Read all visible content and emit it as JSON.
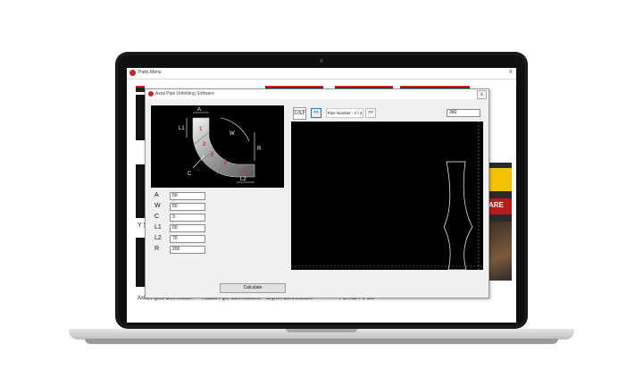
{
  "parts_menu": {
    "title": "Parts Menu",
    "close_label": "x",
    "y_label": "Y S",
    "captions": [
      "Axial Pipes Connection",
      "Radial Pipe Connections",
      "Expert Connections",
      "PLANE PIPES"
    ],
    "ad_text": "ARE"
  },
  "dialog": {
    "title": "Axial Pipe Unfolding Software",
    "close_label": "x",
    "diagram_labels": {
      "A": "A",
      "L1": "L1",
      "W": "W",
      "R": "R",
      "C": "C",
      "L2": "L2",
      "segments": [
        "1",
        "2",
        "2",
        "2",
        "3"
      ]
    },
    "params": [
      {
        "label": "A",
        "value": "50"
      },
      {
        "label": "W",
        "value": "50"
      },
      {
        "label": "C",
        "value": "3"
      },
      {
        "label": "L1",
        "value": "50"
      },
      {
        "label": "L2",
        "value": "70"
      },
      {
        "label": "R",
        "value": "200"
      }
    ],
    "calculate_label": "Calculate",
    "toolbar": {
      "dxf_label": "DXF",
      "prev_label": "<<",
      "pipe_number": "Pipe Number : 2 \\ 3",
      "next_label": ">>",
      "angle_value": "360"
    }
  },
  "colors": {
    "accent_red": "#c62828",
    "canvas_bg": "#000000",
    "selection_blue": "#2a72c8"
  }
}
